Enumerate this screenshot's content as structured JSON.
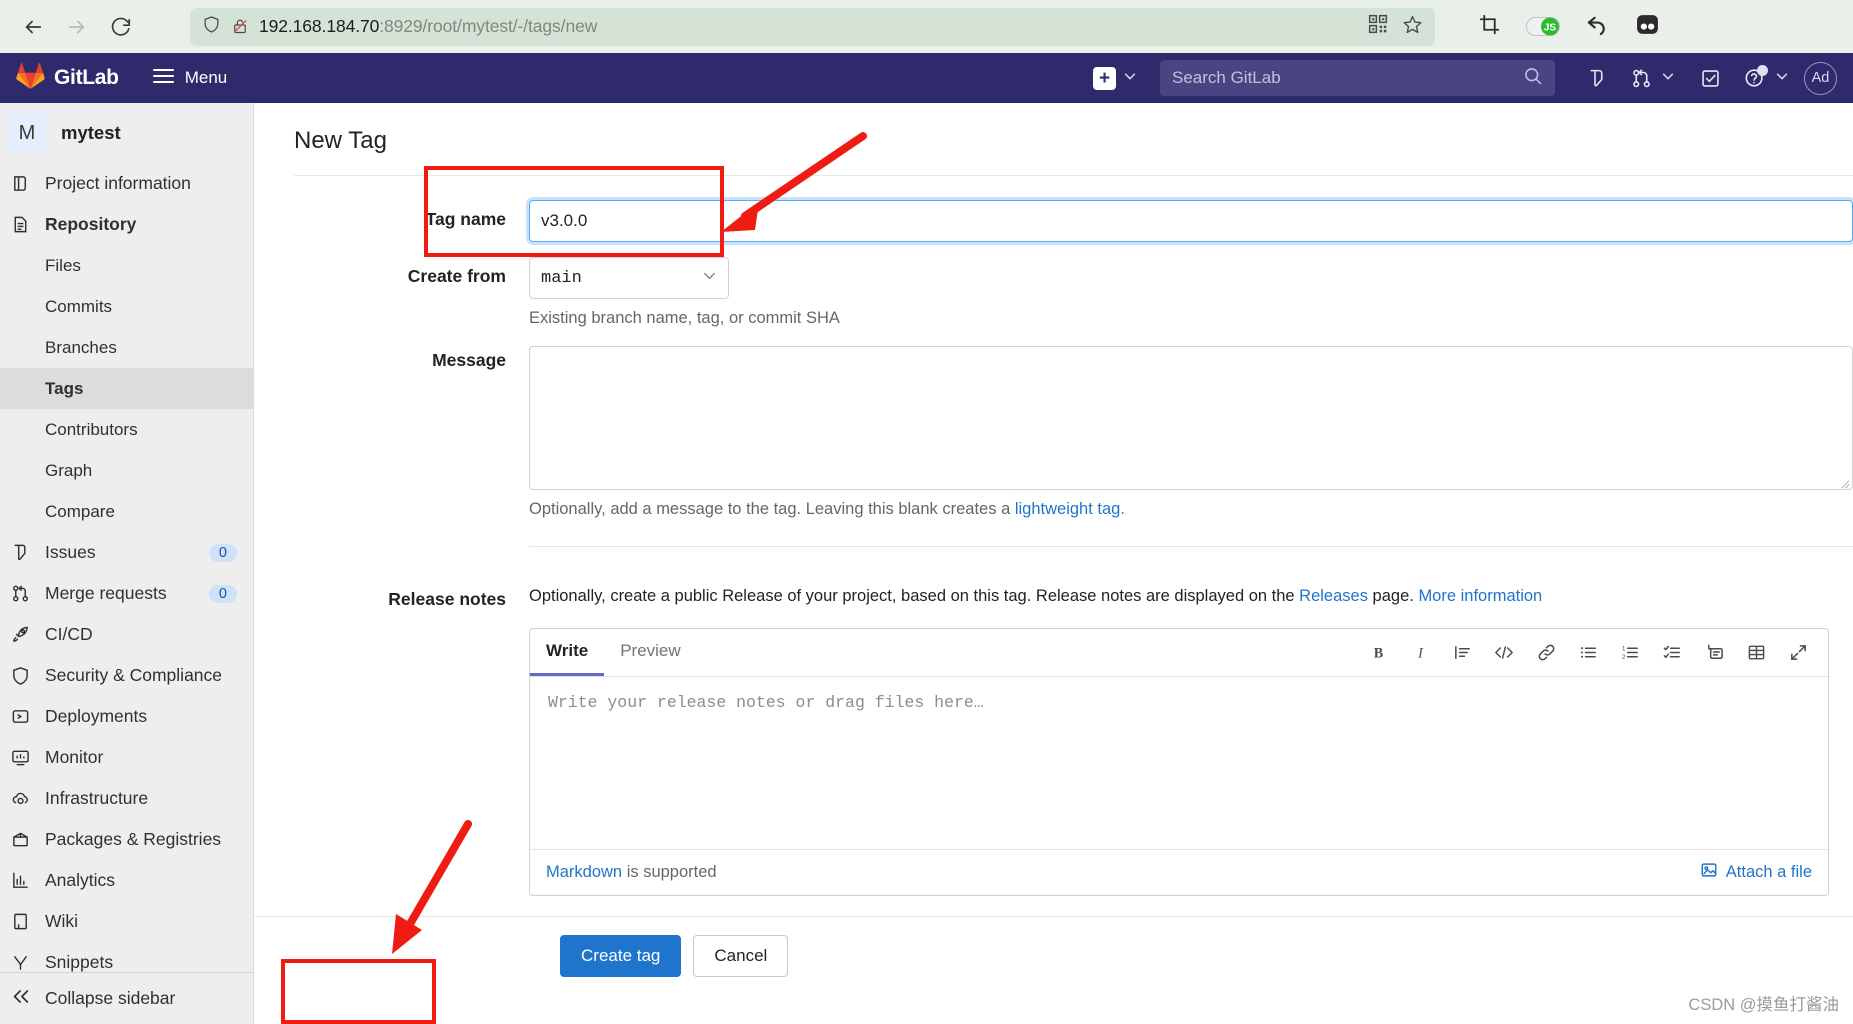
{
  "browser": {
    "back_icon": "arrow-left-icon",
    "forward_icon": "arrow-right-icon",
    "reload_icon": "reload-icon",
    "shield_icon": "shield-icon",
    "lock_broken_icon": "lock-broken-icon",
    "url_host": "192.168.184.70",
    "url_rest": ":8929/root/mytest/-/tags/new",
    "qr_icon": "qr-code-icon",
    "bookmark_icon": "star-icon",
    "extensions": [
      {
        "icon": "crop-tool-icon",
        "label": "Crop"
      },
      {
        "icon": "javascript-toggle-icon",
        "label": "JS"
      },
      {
        "icon": "undo-arrow-icon",
        "label": "Undo"
      },
      {
        "icon": "panda-extension-icon",
        "label": "Extension"
      }
    ]
  },
  "gitlab_header": {
    "brand": "GitLab",
    "logo_icon": "gitlab-tanuki-icon",
    "menu_label": "Menu",
    "menu_icon": "hamburger-icon",
    "new_label": "+",
    "new_chevron_icon": "chevron-down-icon",
    "search_placeholder": "Search GitLab",
    "search_icon": "search-icon",
    "issues_icon": "issues-icon",
    "merge_requests_icon": "merge-request-icon",
    "merge_chevron_icon": "chevron-down-icon",
    "todos_icon": "todo-checkbox-icon",
    "help_icon": "help-question-icon",
    "help_chevron_icon": "chevron-down-icon",
    "avatar_initials": "Ad"
  },
  "sidebar": {
    "project_initial": "M",
    "project_name": "mytest",
    "items": [
      {
        "label": "Project information",
        "icon": "project-info-icon",
        "level": "top"
      },
      {
        "label": "Repository",
        "icon": "repository-icon",
        "level": "top",
        "bold": true
      },
      {
        "label": "Files",
        "level": "sub"
      },
      {
        "label": "Commits",
        "level": "sub"
      },
      {
        "label": "Branches",
        "level": "sub"
      },
      {
        "label": "Tags",
        "level": "sub",
        "active": true
      },
      {
        "label": "Contributors",
        "level": "sub"
      },
      {
        "label": "Graph",
        "level": "sub"
      },
      {
        "label": "Compare",
        "level": "sub"
      },
      {
        "label": "Issues",
        "icon": "issues-icon",
        "level": "top",
        "badge": "0"
      },
      {
        "label": "Merge requests",
        "icon": "merge-request-icon",
        "level": "top",
        "badge": "0"
      },
      {
        "label": "CI/CD",
        "icon": "rocket-icon",
        "level": "top"
      },
      {
        "label": "Security & Compliance",
        "icon": "shield-icon",
        "level": "top"
      },
      {
        "label": "Deployments",
        "icon": "deployments-icon",
        "level": "top"
      },
      {
        "label": "Monitor",
        "icon": "monitor-icon",
        "level": "top"
      },
      {
        "label": "Infrastructure",
        "icon": "cloud-gear-icon",
        "level": "top"
      },
      {
        "label": "Packages & Registries",
        "icon": "package-icon",
        "level": "top"
      },
      {
        "label": "Analytics",
        "icon": "analytics-chart-icon",
        "level": "top"
      },
      {
        "label": "Wiki",
        "icon": "book-icon",
        "level": "top"
      },
      {
        "label": "Snippets",
        "icon": "snippet-icon",
        "level": "top"
      }
    ],
    "collapse_label": "Collapse sidebar",
    "collapse_icon": "chevron-double-left-icon"
  },
  "main": {
    "page_title": "New Tag",
    "tag_name": {
      "label": "Tag name",
      "value": "v3.0.0"
    },
    "create_from": {
      "label": "Create from",
      "value": "main",
      "chevron_icon": "chevron-down-icon",
      "help": "Existing branch name, tag, or commit SHA"
    },
    "message": {
      "label": "Message",
      "value": "",
      "help_prefix": "Optionally, add a message to the tag. Leaving this blank creates a ",
      "help_link": "lightweight tag",
      "help_suffix": "."
    },
    "release_notes": {
      "label": "Release notes",
      "desc_part1": "Optionally, create a public Release of your project, based on this tag. Release notes are displayed on the ",
      "desc_link1": "Releases",
      "desc_part2": " page. ",
      "desc_link2": "More information",
      "tabs": [
        {
          "label": "Write",
          "active": true
        },
        {
          "label": "Preview",
          "active": false
        }
      ],
      "toolbar": [
        {
          "icon": "bold-icon",
          "glyph": "B"
        },
        {
          "icon": "italic-icon",
          "glyph": "I"
        },
        {
          "icon": "quote-icon",
          "glyph": ""
        },
        {
          "icon": "code-icon",
          "glyph": "</>"
        },
        {
          "icon": "link-icon",
          "glyph": ""
        },
        {
          "icon": "bullet-list-icon",
          "glyph": ""
        },
        {
          "icon": "numbered-list-icon",
          "glyph": ""
        },
        {
          "icon": "task-list-icon",
          "glyph": ""
        },
        {
          "icon": "collapsible-section-icon",
          "glyph": ""
        },
        {
          "icon": "table-icon",
          "glyph": ""
        },
        {
          "icon": "fullscreen-icon",
          "glyph": ""
        }
      ],
      "editor_placeholder": "Write your release notes or drag files here…",
      "footer_link": "Markdown",
      "footer_text": " is supported",
      "attach_label": "Attach a file",
      "attach_icon": "attach-image-icon"
    },
    "actions": {
      "submit_label": "Create tag",
      "cancel_label": "Cancel"
    }
  },
  "watermark": "CSDN @摸鱼打酱油"
}
